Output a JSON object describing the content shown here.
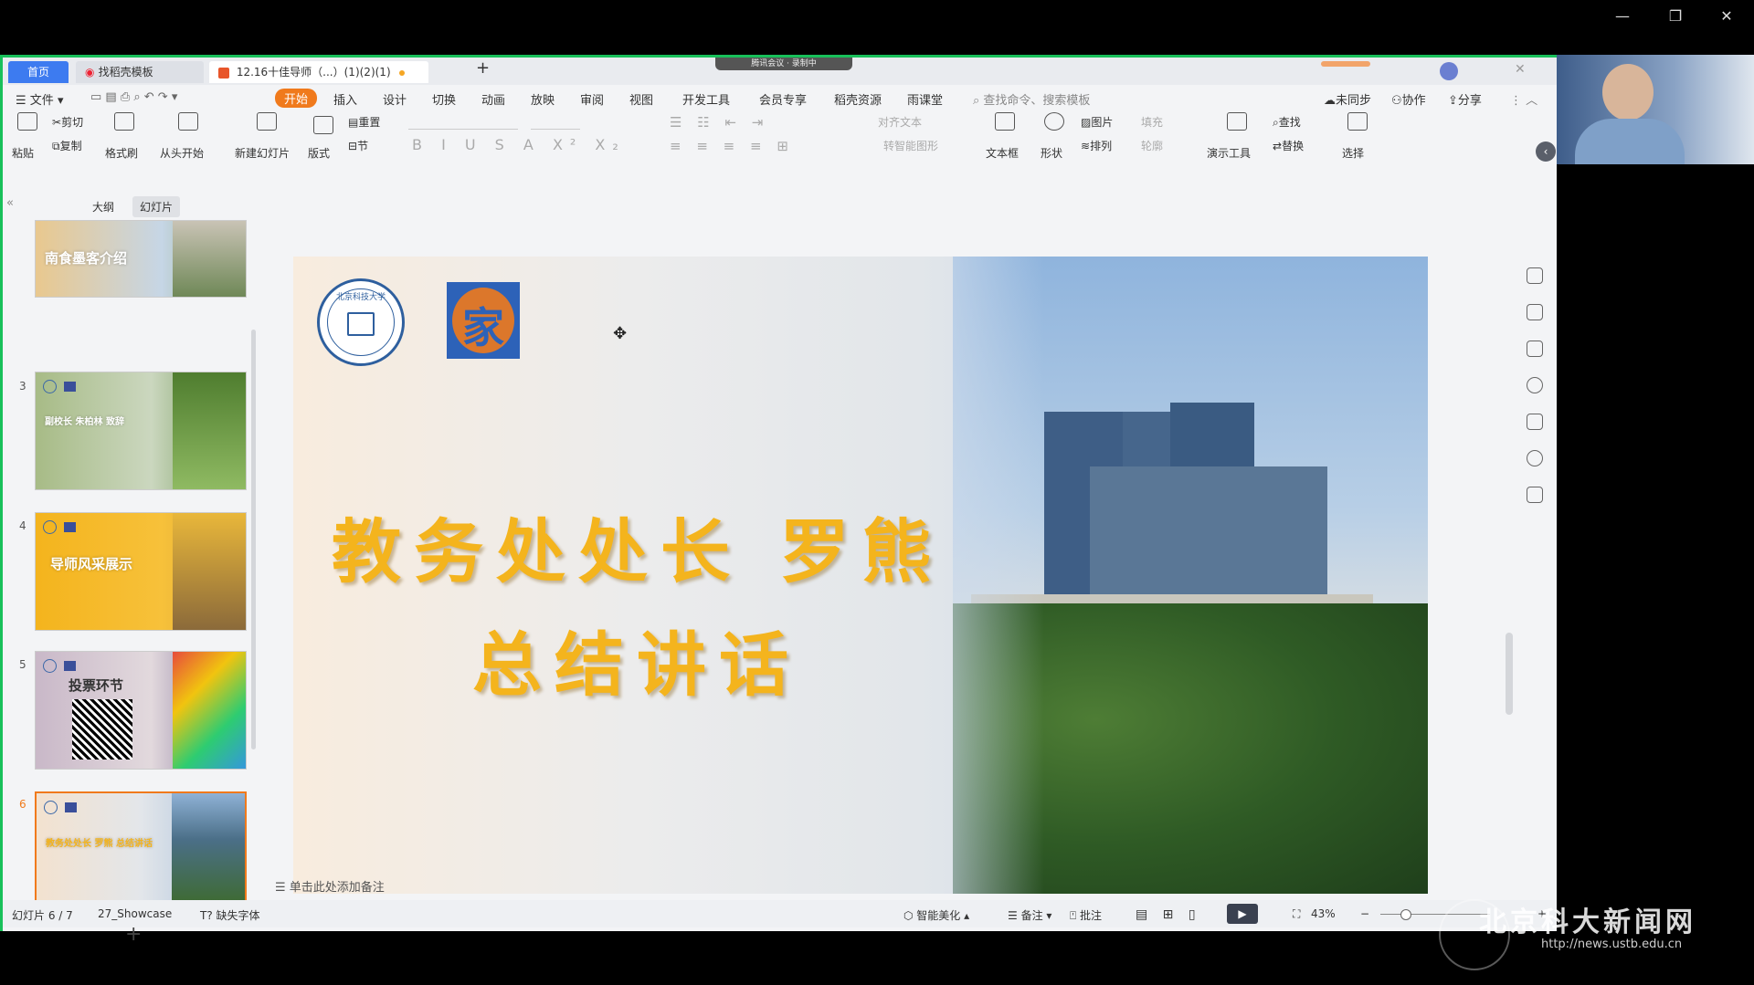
{
  "window": {
    "minimize": "—",
    "restore": "❐",
    "close": "✕"
  },
  "tabs": {
    "home": "首页",
    "template": "找稻壳模板",
    "document": "12.16十佳导师（...）(1)(2)(1)",
    "new_tab": "+"
  },
  "meeting_indicator": "腾讯会议 · 录制中",
  "menu": {
    "file": "文件",
    "items": [
      "开始",
      "插入",
      "设计",
      "切换",
      "动画",
      "放映",
      "审阅",
      "视图",
      "开发工具",
      "会员专享",
      "稻壳资源",
      "雨课堂"
    ],
    "search_placeholder": "查找命令、搜索模板",
    "unsynced": "未同步",
    "collab": "协作",
    "share": "分享"
  },
  "ribbon": {
    "paste": "粘贴",
    "cut": "剪切",
    "copy": "复制",
    "format_painter": "格式刷",
    "from_start": "从头开始",
    "new_slide": "新建幻灯片",
    "layout": "版式",
    "reset": "重置",
    "section": "节",
    "align_text": "对齐文本",
    "smart_shape": "转智能图形",
    "textbox": "文本框",
    "shape": "形状",
    "picture": "图片",
    "fill": "填充",
    "arrange": "排列",
    "outline": "轮廓",
    "present_tools": "演示工具",
    "find": "查找",
    "replace": "替换",
    "select": "选择"
  },
  "left_panel": {
    "tab_outline": "大纲",
    "tab_slides": "幻灯片",
    "slides": [
      {
        "num": "",
        "title": "南食墨客介绍"
      },
      {
        "num": "3",
        "title": "副校长 朱柏林 致辞"
      },
      {
        "num": "4",
        "title": "导师风采展示"
      },
      {
        "num": "5",
        "title": "投票环节"
      },
      {
        "num": "6",
        "title": "教务处处长 罗熊 总结讲话"
      }
    ],
    "add": "+"
  },
  "slide": {
    "line1": "教务处处长 罗熊",
    "line2": "总结讲话",
    "seal_text": "北京科技大学",
    "logo_text": "家"
  },
  "notes_placeholder": "单击此处添加备注",
  "status": {
    "slide_counter": "幻灯片 6 / 7",
    "theme": "27_Showcase",
    "missing_font": "缺失字体",
    "smart_beautify": "智能美化",
    "notes": "备注",
    "comments": "批注",
    "zoom": "43%"
  },
  "watermark": {
    "title": "北京科大新闻网",
    "url": "http://news.ustb.edu.cn"
  },
  "colors": {
    "accent_orange": "#f07a1c",
    "title_yellow": "#f4b41d",
    "frame_green": "#18c05a",
    "tab_blue": "#3d7bf0"
  }
}
